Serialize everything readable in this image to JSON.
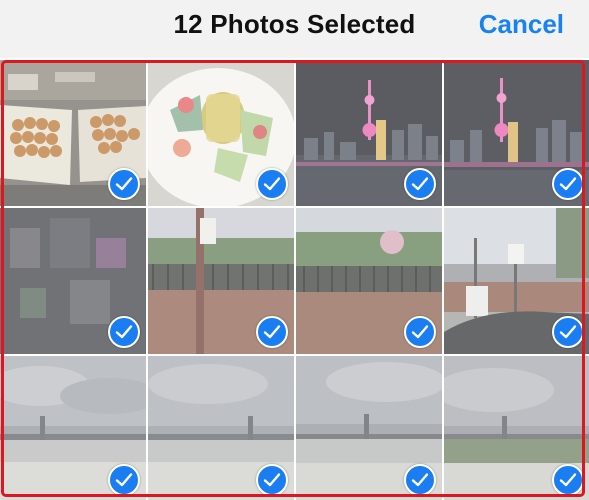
{
  "header": {
    "title": "12 Photos Selected",
    "cancel_label": "Cancel"
  },
  "colors": {
    "accent": "#1a82f0",
    "checkmark_fill": "#1a7ef2",
    "selection_outline": "#e0161e",
    "header_bg": "#f2f2f3"
  },
  "photos": [
    {
      "subject": "pastries on trays",
      "selected": true
    },
    {
      "subject": "fruit plate with drink",
      "selected": true
    },
    {
      "subject": "city skyline at night",
      "selected": true
    },
    {
      "subject": "city skyline at night",
      "selected": true
    },
    {
      "subject": "blurred colors",
      "selected": true
    },
    {
      "subject": "street sign and fence",
      "selected": true
    },
    {
      "subject": "park fence",
      "selected": true
    },
    {
      "subject": "street signs at waterfront",
      "selected": true
    },
    {
      "subject": "cloudy sky over bridge",
      "selected": true
    },
    {
      "subject": "cloudy sky over bridge",
      "selected": true
    },
    {
      "subject": "cloudy sky over bridge",
      "selected": true
    },
    {
      "subject": "cloudy sky over bridge",
      "selected": true
    }
  ]
}
